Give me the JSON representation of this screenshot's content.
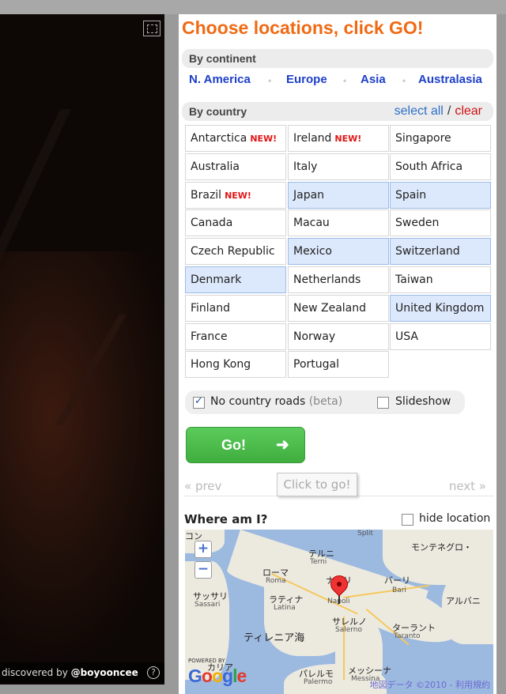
{
  "street_view": {
    "credit_prefix": "discovered by",
    "credit_user": "@boyooncee",
    "help_glyph": "?",
    "fullscreen_icon": "expand-icon"
  },
  "panel": {
    "title": "Choose locations, click GO!",
    "by_continent_label": "By continent",
    "continents": [
      "N. America",
      "Europe",
      "Asia",
      "Australasia"
    ],
    "by_country_label": "By country",
    "select_all": "select all",
    "separator": "/",
    "clear": "clear",
    "new_badge": "NEW!",
    "countries": [
      {
        "name": "Antarctica",
        "new": true,
        "selected": false
      },
      {
        "name": "Ireland",
        "new": true,
        "selected": false
      },
      {
        "name": "Singapore",
        "new": false,
        "selected": false
      },
      {
        "name": "Australia",
        "new": false,
        "selected": false
      },
      {
        "name": "Italy",
        "new": false,
        "selected": false
      },
      {
        "name": "South Africa",
        "new": false,
        "selected": false
      },
      {
        "name": "Brazil",
        "new": true,
        "selected": false
      },
      {
        "name": "Japan",
        "new": false,
        "selected": true
      },
      {
        "name": "Spain",
        "new": false,
        "selected": true
      },
      {
        "name": "Canada",
        "new": false,
        "selected": false
      },
      {
        "name": "Macau",
        "new": false,
        "selected": false
      },
      {
        "name": "Sweden",
        "new": false,
        "selected": false
      },
      {
        "name": "Czech Republic",
        "new": false,
        "selected": false
      },
      {
        "name": "Mexico",
        "new": false,
        "selected": true
      },
      {
        "name": "Switzerland",
        "new": false,
        "selected": true
      },
      {
        "name": "Denmark",
        "new": false,
        "selected": true
      },
      {
        "name": "Netherlands",
        "new": false,
        "selected": false
      },
      {
        "name": "Taiwan",
        "new": false,
        "selected": false
      },
      {
        "name": "Finland",
        "new": false,
        "selected": false
      },
      {
        "name": "New Zealand",
        "new": false,
        "selected": false
      },
      {
        "name": "United Kingdom",
        "new": false,
        "selected": true
      },
      {
        "name": "France",
        "new": false,
        "selected": false
      },
      {
        "name": "Norway",
        "new": false,
        "selected": false
      },
      {
        "name": "USA",
        "new": false,
        "selected": false
      },
      {
        "name": "Hong Kong",
        "new": false,
        "selected": false
      },
      {
        "name": "Portugal",
        "new": false,
        "selected": false
      }
    ],
    "options": {
      "no_country_roads": {
        "label": "No country roads",
        "beta": "(beta)",
        "checked": true
      },
      "slideshow": {
        "label": "Slideshow",
        "checked": false
      }
    },
    "go_button": "Go!",
    "go_arrow": "➜",
    "prev": "« prev",
    "next": "next »",
    "tooltip": "Click to go!",
    "where_am_i": "Where am I?",
    "hide_location": {
      "label": "hide location",
      "checked": false
    }
  },
  "map": {
    "zoom_in": "+",
    "zoom_out": "−",
    "labels": {
      "montenegro": "モンテネグロ・",
      "albania": "アルバニ",
      "split": "Split",
      "terni_jp": "テルニ",
      "terni": "Terni",
      "roma_jp": "ローマ",
      "roma": "Roma",
      "latina_jp": "ラティナ",
      "latina": "Latina",
      "napoli_jp": "ナポリ",
      "napoli": "Napoli",
      "bari_jp": "バーリ",
      "bari": "Bari",
      "salerno_jp": "サレルノ",
      "salerno": "Salerno",
      "taranto_jp": "ターラント",
      "taranto": "Taranto",
      "sassari_jp": "サッサリ",
      "sassari": "Sassari",
      "tyrrhenian": "ティレニア海",
      "cagliari_jp": "カリア",
      "palermo_jp": "パレルモ",
      "palermo": "Palermo",
      "messina_jp": "メッシーナ",
      "messina": "Messina"
    },
    "powered_by": "POWERED BY",
    "google": "Google",
    "copyright": "地図データ ©2010 - 利用規約"
  }
}
